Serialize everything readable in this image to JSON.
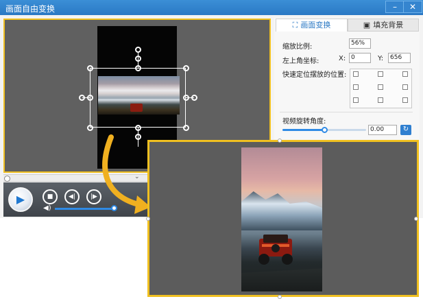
{
  "window": {
    "title": "画面自由变换",
    "minimize_icon": "minimize-icon",
    "close_icon": "close-icon"
  },
  "tabs": [
    {
      "label": "画面变换",
      "icon": "transform-icon",
      "active": true
    },
    {
      "label": "填充背景",
      "icon": "background-icon",
      "active": false
    }
  ],
  "transform": {
    "scale_label": "缩放比例:",
    "scale_value": "56%",
    "top_left_label": "左上角坐标:",
    "x_label": "X:",
    "x_value": "0",
    "y_label": "Y:",
    "y_value": "656",
    "quick_position_label": "快速定位摆放的位置:",
    "rotation_label": "视频旋转角度:",
    "rotation_value": "0.00",
    "rotation_slider_fraction": 0.5
  },
  "player": {
    "volume_fraction": 1.0,
    "play_icon": "play-icon",
    "stop_icon": "stop-icon",
    "prev_icon": "prev-frame-icon",
    "next_icon": "next-frame-icon",
    "volume_icon": "volume-icon"
  },
  "colors": {
    "accent": "#2f8ae5",
    "highlight_border": "#f0c020",
    "titlebar": "#2a78c4"
  }
}
